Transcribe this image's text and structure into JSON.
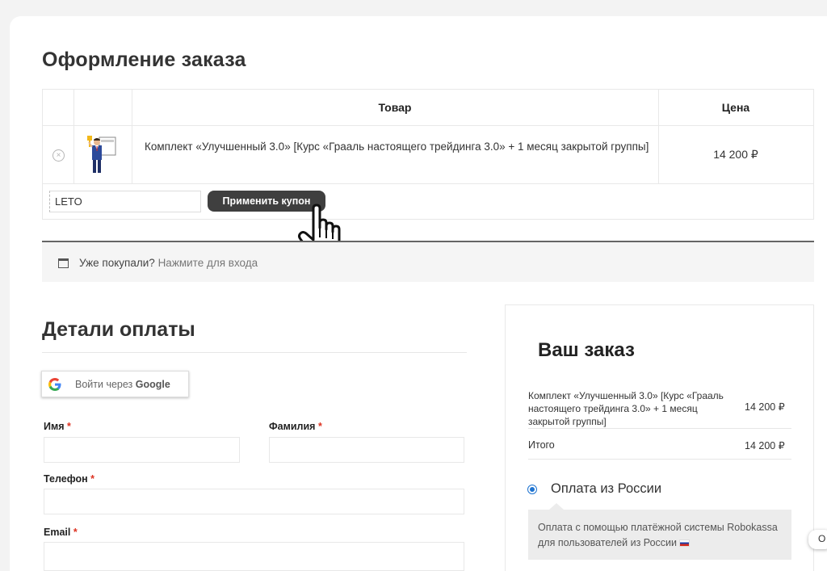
{
  "page": {
    "title": "Оформление заказа"
  },
  "cart": {
    "headers": {
      "product": "Товар",
      "price": "Цена"
    },
    "item": {
      "name": "Комплект «Улучшенный 3.0» [Курс «Грааль настоящего трейдинга 3.0» + 1 месяц закрытой группы]",
      "price": "14 200 ₽",
      "remove_glyph": "×"
    },
    "coupon": {
      "value": "LETO",
      "apply_label": "Применить купон"
    }
  },
  "login_notice": {
    "text": "Уже покупали?",
    "link": "Нажмите для входа"
  },
  "billing": {
    "title": "Детали оплаты",
    "google_prefix": "Войти через",
    "google_brand": "Google",
    "fields": {
      "first_name": "Имя",
      "last_name": "Фамилия",
      "phone": "Телефон",
      "email": "Email",
      "required_mark": "*"
    }
  },
  "order": {
    "title": "Ваш заказ",
    "item_name": "Комплект «Улучшенный 3.0» [Курс «Грааль настоящего трейдинга 3.0» + 1 месяц закрытой группы]",
    "item_price": "14 200 ₽",
    "total_label": "Итого",
    "total_value": "14 200 ₽",
    "payment": {
      "label": "Оплата из России",
      "description": "Оплата с помощью платёжной системы Robokassa для пользователей из России",
      "selected": true
    }
  },
  "side_chip": {
    "text": "O"
  },
  "colors": {
    "button_dark": "#3f3f3f",
    "radio_blue": "#1e73d0",
    "required_red": "#d32222"
  }
}
